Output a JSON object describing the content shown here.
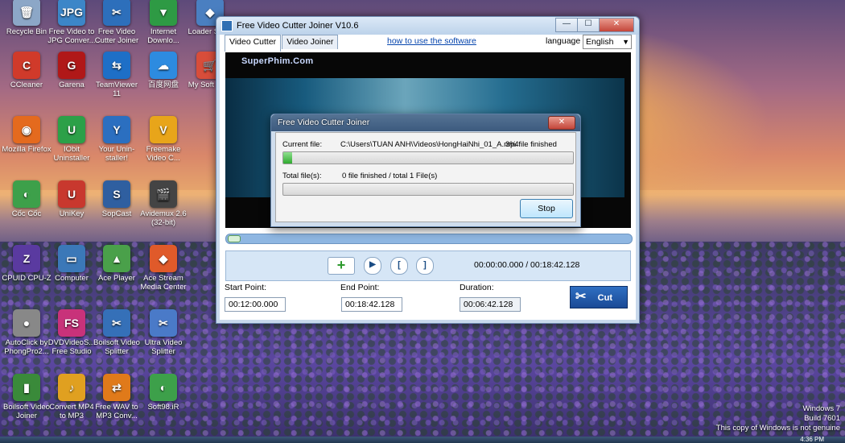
{
  "desktop": {
    "icons": [
      {
        "label": "Recycle Bin",
        "glyph": "🗑",
        "color": "#8ca7c7"
      },
      {
        "label": "Free Video to JPG Conver...",
        "glyph": "JPG",
        "color": "#3c86c8"
      },
      {
        "label": "Free Video Cutter Joiner",
        "glyph": "✂",
        "color": "#2d6fbb"
      },
      {
        "label": "Internet Downlo...",
        "glyph": "▼",
        "color": "#2e9a44"
      },
      {
        "label": "Loader Short",
        "glyph": "◆",
        "color": "#4a7fc1"
      },
      {
        "label": "CCleaner",
        "glyph": "C",
        "color": "#d03a2a"
      },
      {
        "label": "Garena",
        "glyph": "G",
        "color": "#b01818"
      },
      {
        "label": "TeamViewer 11",
        "glyph": "⇆",
        "color": "#1e6fc7"
      },
      {
        "label": "百度网盘",
        "glyph": "☁",
        "color": "#2d8be0"
      },
      {
        "label": "My Soft Deal",
        "glyph": "🛒",
        "color": "#d84d3a"
      },
      {
        "label": "Mozilla Firefox",
        "glyph": "◉",
        "color": "#e46a1e"
      },
      {
        "label": "IObit Uninstaller",
        "glyph": "U",
        "color": "#2ca048"
      },
      {
        "label": "Your Unin-staller!",
        "glyph": "Y",
        "color": "#2b6fc0"
      },
      {
        "label": "Freemake Video C...",
        "glyph": "V",
        "color": "#e8a51a"
      },
      {
        "label": "Cốc Cốc",
        "glyph": "◐",
        "color": "#3da04a"
      },
      {
        "label": "UniKey",
        "glyph": "U",
        "color": "#c8382e"
      },
      {
        "label": "SopCast",
        "glyph": "S",
        "color": "#2f5fa0"
      },
      {
        "label": "Avidemux 2.6 (32-bit)",
        "glyph": "🎬",
        "color": "#444"
      },
      {
        "label": "CPUID CPU-Z",
        "glyph": "Z",
        "color": "#5a3aa0"
      },
      {
        "label": "Computer",
        "glyph": "▭",
        "color": "#3b78b8"
      },
      {
        "label": "Ace Player",
        "glyph": "▲",
        "color": "#4aa04a"
      },
      {
        "label": "Ace Stream Media Center",
        "glyph": "◆",
        "color": "#e05a2a"
      },
      {
        "label": "AutoClick by PhongPro2...",
        "glyph": "●",
        "color": "#888"
      },
      {
        "label": "DVDVideoS... Free Studio",
        "glyph": "FS",
        "color": "#c8327a"
      },
      {
        "label": "Boilsoft Video Splitter",
        "glyph": "✂",
        "color": "#3570b8"
      },
      {
        "label": "Ultra Video Splitter",
        "glyph": "✂",
        "color": "#4a7ac8"
      },
      {
        "label": "Boilsoft Video Joiner",
        "glyph": "▮",
        "color": "#3a8a3a"
      },
      {
        "label": "Convert MP4 to MP3",
        "glyph": "♪",
        "color": "#e0a020"
      },
      {
        "label": "Free WAV to MP3 Conv...",
        "glyph": "⇄",
        "color": "#e07a1a"
      },
      {
        "label": "Soft98.iR",
        "glyph": "◐",
        "color": "#3da04a"
      }
    ],
    "genuine_notice": {
      "line1": "Windows 7",
      "line2": "Build 7601",
      "line3": "This copy of Windows is not genuine"
    },
    "clock": "4:36 PM"
  },
  "app_window": {
    "title": "Free Video Cutter Joiner V10.6",
    "buttons": {
      "minimize": "—",
      "maximize": "☐",
      "close": "✕"
    },
    "tabs": [
      {
        "label": "Video Cutter",
        "active": true
      },
      {
        "label": "Video Joiner",
        "active": false
      }
    ],
    "howto_link": "how to use the software",
    "language_label": "language",
    "language_value": "English",
    "video_watermark": "SuperPhim.Com",
    "controls": {
      "add": "+",
      "play": "▶",
      "mark_in": "[",
      "mark_out": "]"
    },
    "timer": "00:00:00.000 / 00:18:42.128",
    "start_label": "Start Point:",
    "start_value": "00:12:00.000",
    "end_label": "End Point:",
    "end_value": "00:18:42.128",
    "duration_label": "Duration:",
    "duration_value": "00:06:42.128",
    "cut_label": "Cut"
  },
  "progress_dialog": {
    "title": "Free Video Cutter Joiner",
    "close": "✕",
    "current_label": "Current file:",
    "current_path": "C:\\Users\\TUAN ANH\\Videos\\HongHaiNhi_01_A.mp4",
    "current_status": "3% file finished",
    "current_progress": 0.03,
    "total_label": "Total file(s):",
    "total_status": "0 file finished / total 1 File(s)",
    "total_progress": 0,
    "stop_label": "Stop"
  }
}
